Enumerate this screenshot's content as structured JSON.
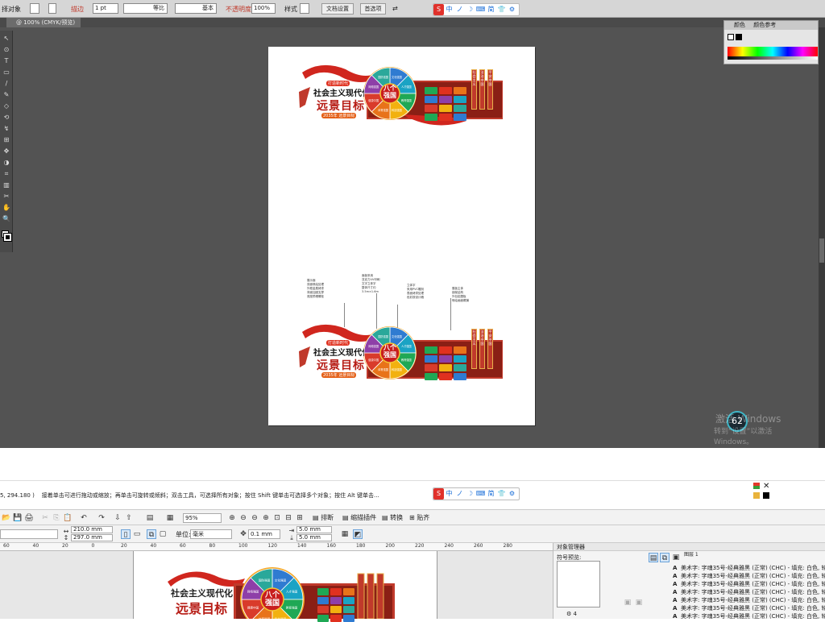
{
  "ai": {
    "control_bar": {
      "selection_label": "择对象",
      "stroke_label": "描边",
      "stroke_value": "1 pt",
      "profile_label": "等比",
      "brush_label": "基本",
      "opacity_label": "不透明度",
      "opacity_value": "100%",
      "style_label": "样式",
      "doc_setup_button": "文档设置",
      "prefs_button": "首选项"
    },
    "doc_tab": "@ 100% (CMYK/预览)",
    "tools": [
      "↖",
      "⊙",
      "T",
      "▭",
      "/",
      "✎",
      "◇",
      "⟲",
      "↯",
      "⊞",
      "✥",
      "◑",
      "⌗",
      "▥",
      "✂",
      "✋",
      "🔍"
    ],
    "color_panel": {
      "tab1": "颜色",
      "tab2": "颜色参考"
    },
    "windows_notice": {
      "line1": "激活 Windows",
      "line2": "转到“设置”以激活 Windows。"
    },
    "perf_meter": "62"
  },
  "ime": {
    "items": [
      "S",
      "中",
      "ノ",
      "☽",
      "⌨",
      "简",
      "👕",
      "⚙"
    ]
  },
  "artwork": {
    "tag": "打造新时代",
    "headline": "社会主义现代化",
    "big_title": "远景目标",
    "sub_tag": "2035年 远景目标",
    "center": "八个\n强国",
    "wheel_labels": [
      "文化强国",
      "人才强国",
      "教育强国",
      "科技强国",
      "体育强国",
      "健康中国",
      "网络强国",
      "国防强国"
    ],
    "side_labels": [
      "社会主义",
      "法治中国",
      "平安中国",
      "美丽中国"
    ],
    "annotations": [
      "展示面\n双面喷绘处理\n外框金属烤漆\n背面加固支撑\n底座预埋螺栓",
      "面板采用\n亚克力UV印刷\n文字立体字\n整体尺寸约\n3.5m×1.6m",
      "立体字\n采用PVC雕刻\n表面烤漆处理\n色彩按设计稿",
      "展板主体\n钢架结构\n外包铝塑板\n喷绘画面覆膜"
    ]
  },
  "corel": {
    "status_coords": "5, 294.180 )",
    "status_hint": "接着单击可进行拖动或缩放；再单击可旋转或倾斜；双击工具，可选择所有对象；按住 Shift 键单击可选择多个对象；按住 Alt 键单击...",
    "toolbar1": {
      "zoom": "95%",
      "b1": "排断",
      "b2": "缩描插件",
      "b3": "转换",
      "b4": "贴齐"
    },
    "toolbar2": {
      "width": "210.0 mm",
      "height": "297.0 mm",
      "unit_label": "单位:",
      "unit": "毫米",
      "nudge": "0.1 mm",
      "dup_x": "5.0 mm",
      "dup_y": "5.0 mm"
    },
    "ruler": [
      "60",
      "40",
      "20",
      "0",
      "20",
      "40",
      "60",
      "80",
      "100",
      "120",
      "140",
      "160",
      "180",
      "200",
      "220",
      "240",
      "260",
      "280"
    ],
    "objmgr": {
      "title": "对象管理器",
      "sym_label": "符号预览:",
      "layer_num": "4",
      "header_code": "图层 1",
      "rows": [
        "美术字: 字魂35号-经典雅黑 (正常) (CHC) - 填充: 白色, 轮",
        "美术字: 字魂35号-经典雅黑 (正常) (CHC) - 填充: 白色, 轮",
        "美术字: 字魂35号-经典雅黑 (正常) (CHC) - 填充: 白色, 轮",
        "美术字: 字魂35号-经典雅黑 (正常) (CHC) - 填充: 白色, 轮",
        "美术字: 字魂35号-经典雅黑 (正常) (CHC) - 填充: 白色, 轮",
        "美术字: 字魂35号-经典雅黑 (正常) (CHC) - 填充: 白色, 轮",
        "美术字: 字魂35号-经典雅黑 (正常) (CHC) - 填充: 白色, 轮"
      ]
    }
  },
  "colors": {
    "accent_red": "#c0392b",
    "wheel": [
      "#2f7bd1",
      "#1aa3c4",
      "#1fa855",
      "#f2b10f",
      "#e8731a",
      "#d93b2b",
      "#8e3fa8",
      "#2aa89a"
    ]
  }
}
